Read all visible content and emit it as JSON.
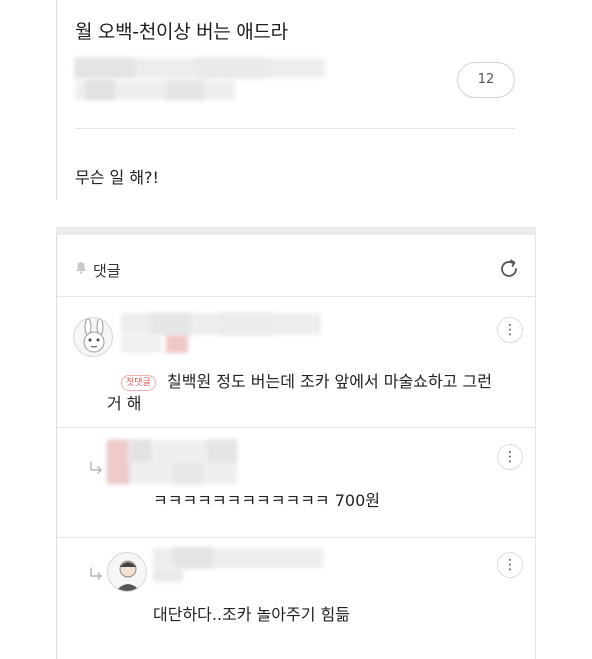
{
  "post": {
    "title": "월 오백-천이상 버는 애드라",
    "comment_count": "12",
    "body": "무슨 일 해?!"
  },
  "comments_section": {
    "label": "댓글",
    "bell_icon": "bell-icon",
    "refresh_icon": "refresh-icon"
  },
  "comments": [
    {
      "badge": "첫댓글",
      "text": "칠백원 정도 버는데 조카 앞에서 마술쇼하고 그런 거 해",
      "avatar_icon": "rabbit-character-icon",
      "menu_icon": "more-vertical-icon"
    },
    {
      "text": "ㅋㅋㅋㅋㅋㅋㅋㅋㅋㅋㅋㅋ 700원",
      "reply_icon": "reply-arrow-icon",
      "menu_icon": "more-vertical-icon"
    },
    {
      "text": "대단하다..조카 놀아주기 힘듦",
      "reply_icon": "reply-arrow-icon",
      "avatar_icon": "cartoon-person-icon",
      "menu_icon": "more-vertical-icon"
    }
  ],
  "colors": {
    "badge": "#e05a5a",
    "border": "#dcdcdc",
    "separator": "#ececec",
    "blur_pink": "#f1c6c6"
  },
  "kebab_glyph": "⋮"
}
